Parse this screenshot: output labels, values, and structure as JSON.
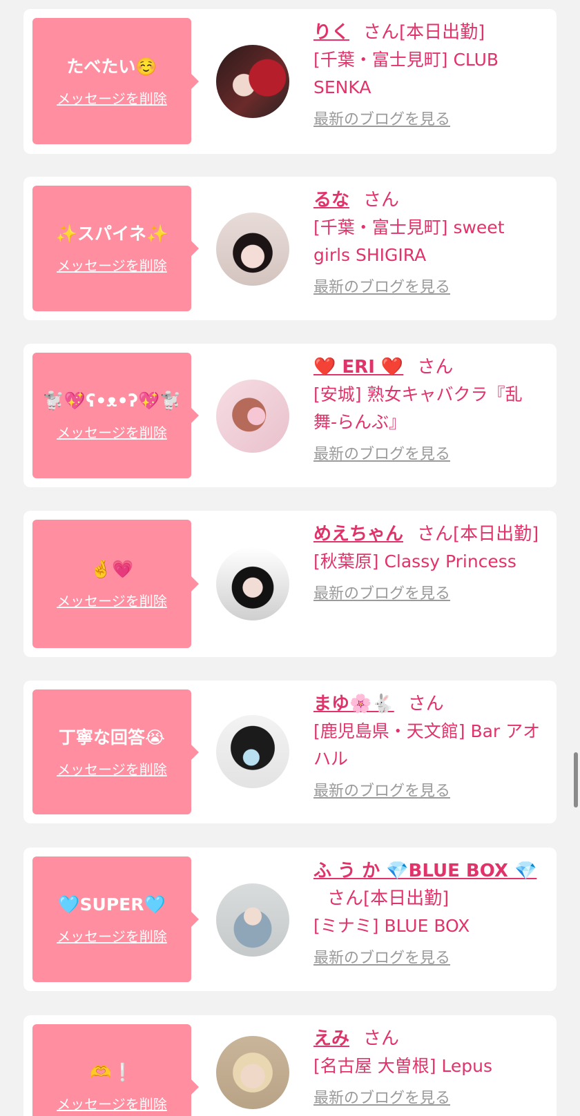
{
  "delete_label": "メッセージを削除",
  "san_label": "さん",
  "blog_label": "最新のブログを見る",
  "colors": {
    "page_bg": "#f2f2f2",
    "bubble": "#ff8fa0",
    "accent": "#e0336a",
    "muted": "#9a9a9a"
  },
  "items": [
    {
      "message": "たべたい☺️",
      "name": "りく",
      "status": "[本日出勤]",
      "shop": "[千葉・富士見町] CLUB SENKA"
    },
    {
      "message": "✨スパイネ✨",
      "name": "るな",
      "status": "",
      "shop": "[千葉・富士見町] sweet girls SHIGIRA"
    },
    {
      "message": "🐩💖ʕ•ᴥ•ʔ💖🐩",
      "name": "❤️ ERI ❤️",
      "status": "",
      "shop": "[安城] 熟女キャバクラ『乱舞-らんぶ』"
    },
    {
      "message": "🤞💗",
      "name": "めえちゃん",
      "status": "[本日出勤]",
      "shop": "[秋葉原] Classy Princess"
    },
    {
      "message": "丁寧な回答😭",
      "name": "まゆ🌸🐇",
      "status": "",
      "shop": "[鹿児島県・天文館] Bar アオハル"
    },
    {
      "message": "🩵SUPER🩵",
      "name": "ふ う か 💎BLUE BOX 💎",
      "status": "[本日出勤]",
      "shop": "[ミナミ] BLUE BOX"
    },
    {
      "message": "🫶❕",
      "name": "えみ",
      "status": "",
      "shop": "[名古屋 大曽根] Lepus"
    }
  ]
}
